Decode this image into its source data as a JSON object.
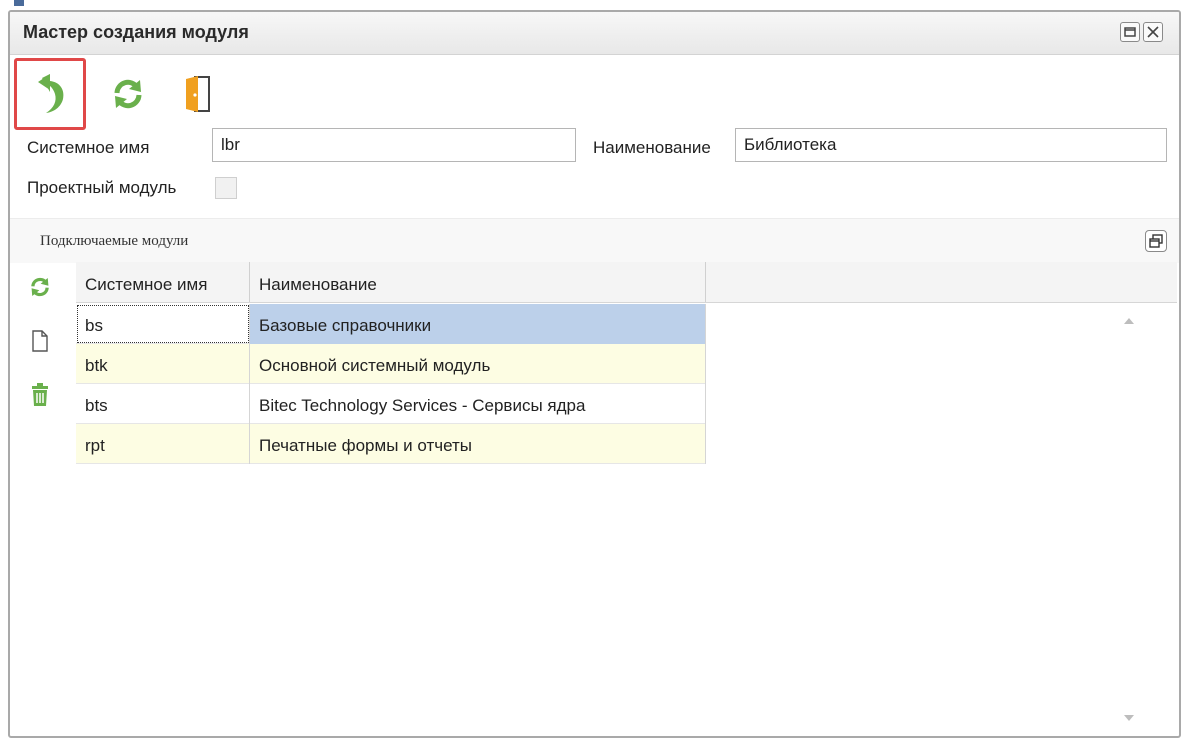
{
  "window": {
    "title": "Мастер создания модуля"
  },
  "toolbar": {
    "back_icon": "undo-arrow-icon",
    "refresh_icon": "refresh-icon",
    "exit_icon": "exit-door-icon"
  },
  "form": {
    "system_name_label": "Системное имя",
    "system_name_value": "lbr",
    "name_label": "Наименование",
    "name_value": "Библиотека",
    "project_module_label": "Проектный модуль",
    "project_module_checked": false
  },
  "modules_panel": {
    "title": "Подключаемые модули",
    "columns": [
      "Системное имя",
      "Наименование"
    ],
    "rows": [
      {
        "system_name": "bs",
        "name": "Базовые справочники",
        "selected": true
      },
      {
        "system_name": "btk",
        "name": "Основной системный модуль",
        "selected": false
      },
      {
        "system_name": "bts",
        "name": "Bitec Technology Services - Сервисы ядра",
        "selected": false
      },
      {
        "system_name": "rpt",
        "name": "Печатные формы и отчеты",
        "selected": false
      }
    ]
  },
  "colors": {
    "accent_green": "#6ab04c",
    "exit_orange": "#f0a020",
    "highlight_red": "#e04848",
    "selected_cell": "#bcd0ea",
    "alt_row": "#fdfde3"
  }
}
